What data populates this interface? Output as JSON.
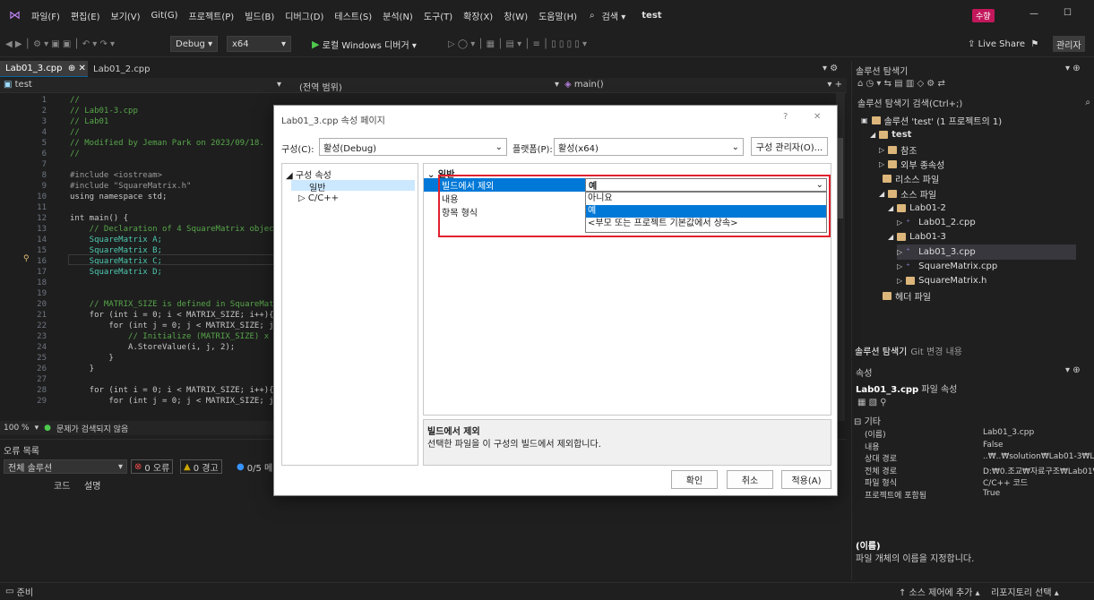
{
  "menu": {
    "items": [
      "파일(F)",
      "편집(E)",
      "보기(V)",
      "Git(G)",
      "프로젝트(P)",
      "빌드(B)",
      "디버그(D)",
      "테스트(S)",
      "분석(N)",
      "도구(T)",
      "확장(X)",
      "창(W)",
      "도움말(H)"
    ],
    "search": "검색 ▾",
    "solution_name": "test",
    "user_badge": "수향"
  },
  "toolbar": {
    "config": "Debug",
    "platform": "x64",
    "run_label": "로컬 Windows 디버거 ▾",
    "live_share": "Live Share",
    "admin": "관리자"
  },
  "editor": {
    "tab_active": "Lab01_3.cpp",
    "tab_other": "Lab01_2.cpp",
    "project_combo": "test",
    "scope_combo": "(전역 범위)",
    "function_combo": "main()",
    "zoom": "100 %",
    "issues": "문제가 검색되지 않음"
  },
  "code": {
    "line_numbers": [
      "1",
      "2",
      "3",
      "4",
      "5",
      "6",
      "7",
      "8",
      "9",
      "10",
      "11",
      "12",
      "13",
      "14",
      "15",
      "16",
      "17",
      "18",
      "19",
      "20",
      "21",
      "22",
      "23",
      "24",
      "25",
      "26",
      "27",
      "28",
      "29"
    ],
    "lines": [
      "//",
      "// Lab01-3.cpp",
      "// Lab01",
      "//",
      "// Modified by Jeman Park on 2023/09/18.",
      "//",
      "",
      "#include <iostream>",
      "#include \"SquareMatrix.h\"",
      "using namespace std;",
      "",
      "int main() {",
      "    // Declaration of 4 SquareMatrix objects",
      "    SquareMatrix A;",
      "    SquareMatrix B;",
      "    SquareMatrix C;",
      "    SquareMatrix D;",
      "",
      "",
      "    // MATRIX_SIZE is defined in SquareMatr",
      "    for (int i = 0; i < MATRIX_SIZE; i++){",
      "        for (int j = 0; j < MATRIX_SIZE; j++",
      "            // Initialize (MATRIX_SIZE) x (M",
      "            A.StoreValue(i, j, 2);",
      "        }",
      "    }",
      "",
      "    for (int i = 0; i < MATRIX_SIZE; i++){",
      "        for (int j = 0; j < MATRIX_SIZE; j++"
    ]
  },
  "error_list": {
    "title": "오류 목록",
    "scope": "전체 솔루션",
    "errors": "0 오류",
    "warnings": "0 경고",
    "messages": "0/5 메",
    "col_code": "코드",
    "col_desc": "설명"
  },
  "status": {
    "ready": "준비",
    "source_control": "↑ 소스 제어에 추가 ▴",
    "repo": "리포지토리 선택 ▴"
  },
  "solution_explorer": {
    "title": "솔루션 탐색기",
    "search": "솔루션 탐색기 검색(Ctrl+;)",
    "items": [
      "솔루션 'test' (1 프로젝트의 1)",
      "test",
      "참조",
      "외부 종속성",
      "리소스 파일",
      "소스 파일",
      "Lab01-2",
      "Lab01_2.cpp",
      "Lab01-3",
      "Lab01_3.cpp",
      "SquareMatrix.cpp",
      "SquareMatrix.h",
      "헤더 파일"
    ],
    "bottom_tab_active": "솔루션 탐색기",
    "bottom_tab_other": "Git 변경 내용"
  },
  "properties": {
    "title": "속성",
    "subject": "Lab01_3.cpp",
    "subject_suffix": "파일 속성",
    "category": "기타",
    "rows": [
      {
        "k": "(이름)",
        "v": "Lab01_3.cpp"
      },
      {
        "k": "내용",
        "v": "False"
      },
      {
        "k": "상대 경로",
        "v": "..₩..₩solution₩Lab01-3₩La"
      },
      {
        "k": "전체 경로",
        "v": "D:₩0.조교₩자료구조₩Lab01₩"
      },
      {
        "k": "파일 형식",
        "v": "C/C++ 코드"
      },
      {
        "k": "프로젝트에 포함됨",
        "v": "True"
      }
    ],
    "desc_title": "(이름)",
    "desc_text": "파일 개체의 이름을 지정합니다."
  },
  "dialog": {
    "title": "Lab01_3.cpp 속성 페이지",
    "help": "?",
    "close": "✕",
    "config_label": "구성(C):",
    "config_value": "활성(Debug)",
    "platform_label": "플랫폼(P):",
    "platform_value": "활성(x64)",
    "config_manager": "구성 관리자(O)...",
    "tree_root": "구성 속성",
    "tree_general": "일반",
    "tree_cpp": "C/C++",
    "section": "일반",
    "props": [
      {
        "k": "빌드에서 제외",
        "v": "예"
      },
      {
        "k": "내용",
        "v": ""
      },
      {
        "k": "항목 형식",
        "v": ""
      }
    ],
    "dropdown_options": [
      "아니요",
      "예",
      "<부모 또는 프로젝트 기본값에서 상속>"
    ],
    "desc_title": "빌드에서 제외",
    "desc_text": "선택한 파일을 이 구성의 빌드에서 제외합니다.",
    "ok": "확인",
    "cancel": "취소",
    "apply": "적용(A)"
  },
  "colors": {
    "accent": "#0e639c",
    "highlight_box": "#e0212e",
    "selected": "#0078d7",
    "selected_nav": "#cce8ff"
  }
}
